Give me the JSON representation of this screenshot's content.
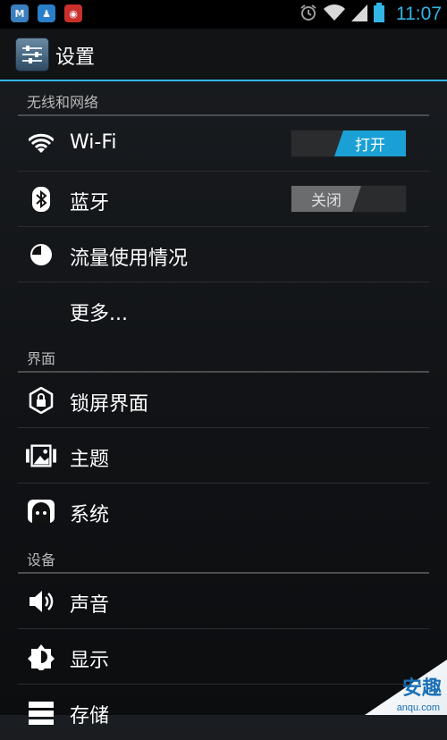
{
  "statusbar": {
    "apps": [
      {
        "name": "m-app-icon",
        "glyph": "M",
        "color": "#3a7fbf"
      },
      {
        "name": "qq-penguin-icon",
        "glyph": "♟",
        "color": "#2a80c8"
      },
      {
        "name": "weibo-icon",
        "glyph": "◉",
        "color": "#c9302c"
      }
    ],
    "time": "11:07"
  },
  "actionbar": {
    "title": "设置"
  },
  "sections": [
    {
      "label": "无线和网络",
      "items": [
        {
          "name": "wifi",
          "icon": "wifi-icon",
          "label": "Wi-Fi",
          "toggle": "on",
          "toggle_label": "打开"
        },
        {
          "name": "bluetooth",
          "icon": "bluetooth-icon",
          "label": "蓝牙",
          "toggle": "off",
          "toggle_label": "关闭"
        },
        {
          "name": "data-usage",
          "icon": "data-usage-icon",
          "label": "流量使用情况"
        },
        {
          "name": "more",
          "icon": "",
          "label": "更多..."
        }
      ]
    },
    {
      "label": "界面",
      "items": [
        {
          "name": "lock-screen",
          "icon": "lock-icon",
          "label": "锁屏界面"
        },
        {
          "name": "theme",
          "icon": "theme-icon",
          "label": "主题"
        },
        {
          "name": "system",
          "icon": "system-icon",
          "label": "系统"
        }
      ]
    },
    {
      "label": "设备",
      "items": [
        {
          "name": "sound",
          "icon": "speaker-icon",
          "label": "声音"
        },
        {
          "name": "display",
          "icon": "brightness-icon",
          "label": "显示"
        },
        {
          "name": "storage",
          "icon": "storage-icon",
          "label": "存储"
        }
      ]
    }
  ],
  "watermark": {
    "text": "安趣",
    "sub": "anqu.com"
  },
  "colors": {
    "accent": "#33b5e5",
    "toggle_on": "#1aa0d4"
  }
}
